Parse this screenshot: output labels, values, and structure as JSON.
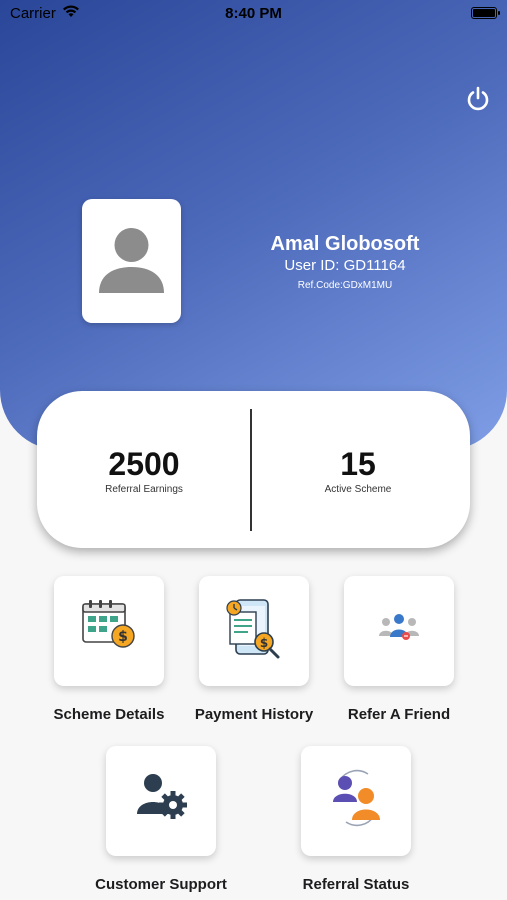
{
  "status_bar": {
    "carrier": "Carrier",
    "time": "8:40 PM"
  },
  "profile": {
    "name": "Amal Globosoft",
    "user_id": "User ID: GD11164",
    "ref_code": "Ref.Code:GDxM1MU"
  },
  "stats": [
    {
      "value": "2500",
      "label": "Referral Earnings"
    },
    {
      "value": "15",
      "label": "Active Scheme"
    }
  ],
  "menu": [
    {
      "label": "Scheme Details",
      "icon": "calendar-dollar-icon"
    },
    {
      "label": "Payment History",
      "icon": "payment-history-icon"
    },
    {
      "label": "Refer A Friend",
      "icon": "refer-friend-icon"
    },
    {
      "label": "Customer Support",
      "icon": "customer-support-icon"
    },
    {
      "label": "Referral Status",
      "icon": "referral-status-icon"
    }
  ],
  "colors": {
    "header_start": "#2a4698",
    "header_end": "#7f9ee6",
    "accent_orange": "#f5a623"
  }
}
